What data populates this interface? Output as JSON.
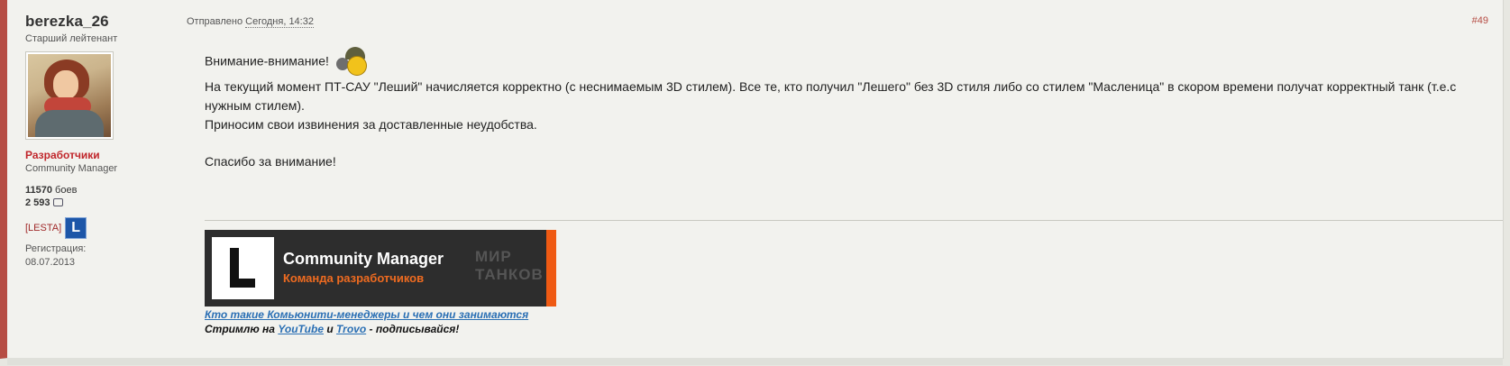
{
  "author": {
    "name": "berezka_26",
    "rank": "Старший лейтенант",
    "group": "Разработчики",
    "title": "Community Manager",
    "battles_value": "11570",
    "battles_label": "боев",
    "posts_value": "2 593",
    "clan": "[LESTA]",
    "clan_logo": "L",
    "reg_label": "Регистрация:",
    "reg_date": "08.07.2013"
  },
  "meta": {
    "sent_label": "Отправлено",
    "date": "Сегодня, 14:32",
    "post_number": "#49"
  },
  "content": {
    "greeting": "Внимание-внимание!",
    "paragraph1": "На текущий момент ПТ-САУ \"Леший\" начисляется корректно (с неснимаемым 3D стилем). Все те, кто получил \"Лешего\" без 3D стиля либо со стилем \"Масленица\" в скором времени получат корректный танк (т.е.с нужным стилем).",
    "paragraph2": "Приносим свои извинения за доставленные неудобства.",
    "thanks": "Спасибо за внимание!"
  },
  "signature": {
    "banner_logo": "L",
    "banner_title": "Community Manager",
    "banner_subtitle": "Команда разработчиков",
    "banner_game_line1": "МИР",
    "banner_game_line2": "ТАНКОВ",
    "link_text": "Кто такие Комьюнити-менеджеры и чем они занимаются",
    "stream_prefix": "Стримлю на",
    "youtube": "YouTube",
    "and": "и",
    "trovo": "Trovo",
    "stream_suffix": "- подписывайся!"
  },
  "colors": {
    "accent_red": "#b64d44",
    "group_red": "#c0262b",
    "link_blue": "#2a6fb4",
    "banner_orange": "#ef5a13"
  }
}
